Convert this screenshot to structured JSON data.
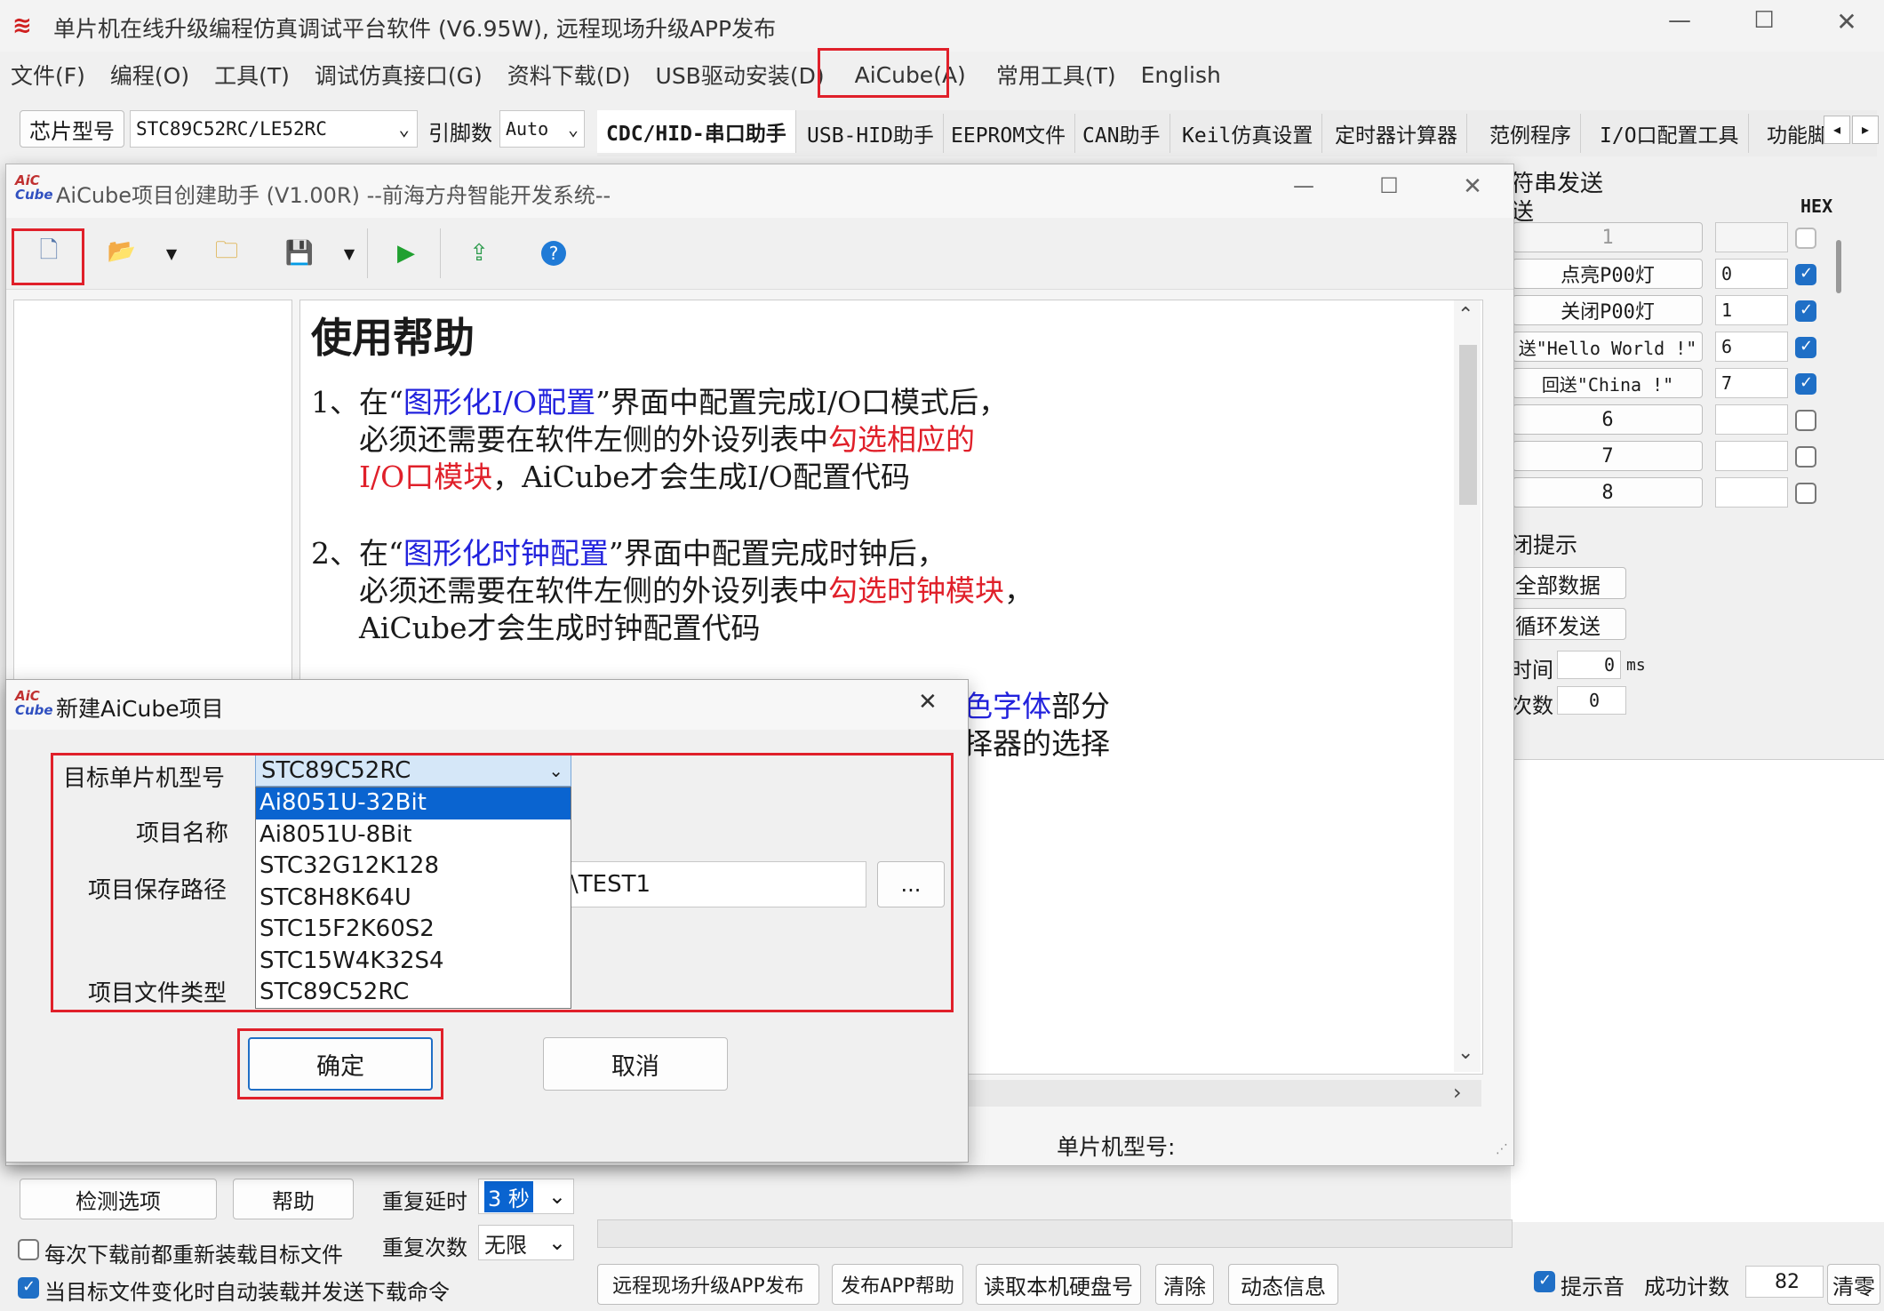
{
  "main_window": {
    "title": "单片机在线升级编程仿真调试平台软件 (V6.95W), 远程现场升级APP发布",
    "menu": [
      "文件(F)",
      "编程(O)",
      "工具(T)",
      "调试仿真接口(G)",
      "资料下载(D)",
      "USB驱动安装(D)",
      "AiCube(A)",
      "常用工具(T)",
      "English"
    ],
    "chip_label": "芯片型号",
    "chip_value": "STC89C52RC/LE52RC",
    "pins_label": "引脚数",
    "pins_value": "Auto",
    "tabs": [
      "CDC/HID-串口助手",
      "USB-HID助手",
      "EEPROM文件",
      "CAN助手",
      "Keil仿真设置",
      "定时器计算器",
      "范例程序",
      "I/O口配置工具",
      "功能脚"
    ],
    "right_panel": {
      "group_title": "符串发送",
      "col_send": "送",
      "col_hex": "HEX",
      "rows": [
        {
          "label": "1",
          "value": "",
          "hex": false
        },
        {
          "label": "点亮P00灯",
          "value": "0",
          "hex": true
        },
        {
          "label": "关闭P00灯",
          "value": "1",
          "hex": true
        },
        {
          "label": "送\"Hello World !\"",
          "value": "6",
          "hex": true
        },
        {
          "label": "回送\"China !\"",
          "value": "7",
          "hex": true
        },
        {
          "label": "6",
          "value": "",
          "hex": false
        },
        {
          "label": "7",
          "value": "",
          "hex": false
        },
        {
          "label": "8",
          "value": "",
          "hex": false
        }
      ],
      "tip_label": "闭提示",
      "btn_all": "全部数据",
      "btn_loop": "循环发送",
      "interval_label": "时间",
      "interval_value": "0",
      "interval_unit": "ms",
      "count_label": "次数",
      "count_value": "0"
    },
    "bottom": {
      "detect_btn": "检测选项",
      "help_btn": "帮助",
      "repeat_delay_label": "重复延时",
      "repeat_delay_value": "3 秒",
      "repeat_count_label": "重复次数",
      "repeat_count_value": "无限",
      "cb1": "每次下载前都重新装载目标文件",
      "cb2": "当目标文件变化时自动装载并发送下载命令",
      "btn_remote": "远程现场升级APP发布",
      "btn_release_help": "发布APP帮助",
      "btn_read_hdd": "读取本机硬盘号",
      "btn_clear": "清除",
      "btn_dynamic": "动态信息",
      "tone_label": "提示音",
      "success_label": "成功计数",
      "success_value": "82",
      "clear_zero": "清零"
    }
  },
  "aicube_window": {
    "title": "AiCube项目创建助手 (V1.00R) --前海方舟智能开发系统--",
    "help_title": "使用帮助",
    "p1": {
      "num": "1、",
      "a": "在“",
      "b": "图形化I/O配置",
      "c": "”界面中配置完成I/O口模式后，",
      "d": "必须还需要在软件左侧的外设列表中",
      "e": "勾选相应的",
      "f": "I/O口模块",
      "g": "，AiCube才会生成I/O配置代码"
    },
    "p2": {
      "num": "2、",
      "a": "在“",
      "b": "图形化时钟配置",
      "c": "”界面中配置完成时钟后，",
      "d": "必须还需要在软件左侧的外设列表中",
      "e": "勾选时钟模块",
      "f": "，",
      "g": "AiCube才会生成时钟配置代码"
    },
    "p3_tail1a": "色字体",
    "p3_tail1b": "部分",
    "p3_tail2": "择器的选择",
    "status_label": "单片机型号:"
  },
  "dialog": {
    "title": "新建AiCube项目",
    "target_label": "目标单片机型号",
    "target_value": "STC89C52RC",
    "name_label": "项目名称",
    "path_label": "项目保存路径",
    "path_value": "\\TEST1",
    "browse": "...",
    "type_label": "项目文件类型",
    "options": [
      "Ai8051U-32Bit",
      "Ai8051U-8Bit",
      "STC32G12K128",
      "STC8H8K64U",
      "STC15F2K60S2",
      "STC15W4K32S4",
      "STC89C52RC"
    ],
    "ok": "确定",
    "cancel": "取消"
  },
  "colors": {
    "red_box": "#e0202a",
    "link_blue": "#2222dd",
    "text_red": "#e0202a",
    "select_blue": "#0a64d0"
  }
}
